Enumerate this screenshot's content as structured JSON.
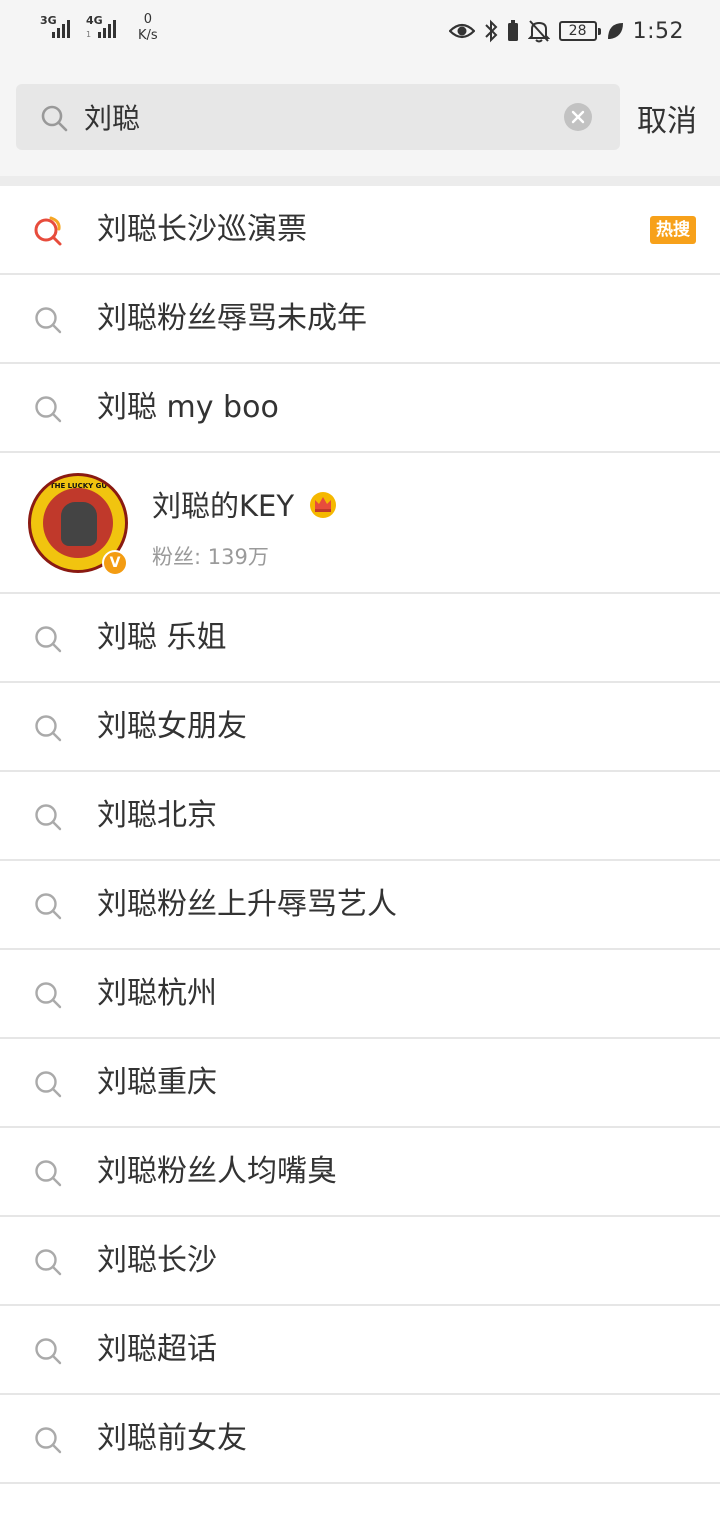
{
  "status_bar": {
    "signal1_label": "3G",
    "signal2_label": "4G",
    "signal2_sub": "1",
    "speed_value": "0",
    "speed_unit": "K/s",
    "battery": "28",
    "time": "1:52",
    "icons": [
      "eye-icon",
      "bluetooth-icon",
      "bell-off-icon",
      "battery-icon",
      "leaf-icon"
    ]
  },
  "search": {
    "query": "刘聪",
    "cancel_label": "取消"
  },
  "suggestions_top": [
    {
      "text": "刘聪长沙巡演票",
      "hot": true,
      "badge": "热搜"
    },
    {
      "text": "刘聪粉丝辱骂未成年",
      "hot": false
    },
    {
      "text": "刘聪 my boo",
      "hot": false
    }
  ],
  "user_card": {
    "name": "刘聪的KEY",
    "fans": "粉丝: 139万",
    "verified_badge": "V",
    "avatar_text": "THE LUCKY GUY"
  },
  "suggestions_bottom": [
    {
      "text": "刘聪 乐姐"
    },
    {
      "text": "刘聪女朋友"
    },
    {
      "text": "刘聪北京"
    },
    {
      "text": "刘聪粉丝上升辱骂艺人"
    },
    {
      "text": "刘聪杭州"
    },
    {
      "text": "刘聪重庆"
    },
    {
      "text": "刘聪粉丝人均嘴臭"
    },
    {
      "text": "刘聪长沙"
    },
    {
      "text": "刘聪超话"
    },
    {
      "text": "刘聪前女友"
    }
  ],
  "colors": {
    "hot_badge": "#f7a11a",
    "hot_icon": "#e74c3c",
    "hot_icon_accent": "#f5a623",
    "text": "#333333",
    "muted": "#9a9a9a"
  }
}
